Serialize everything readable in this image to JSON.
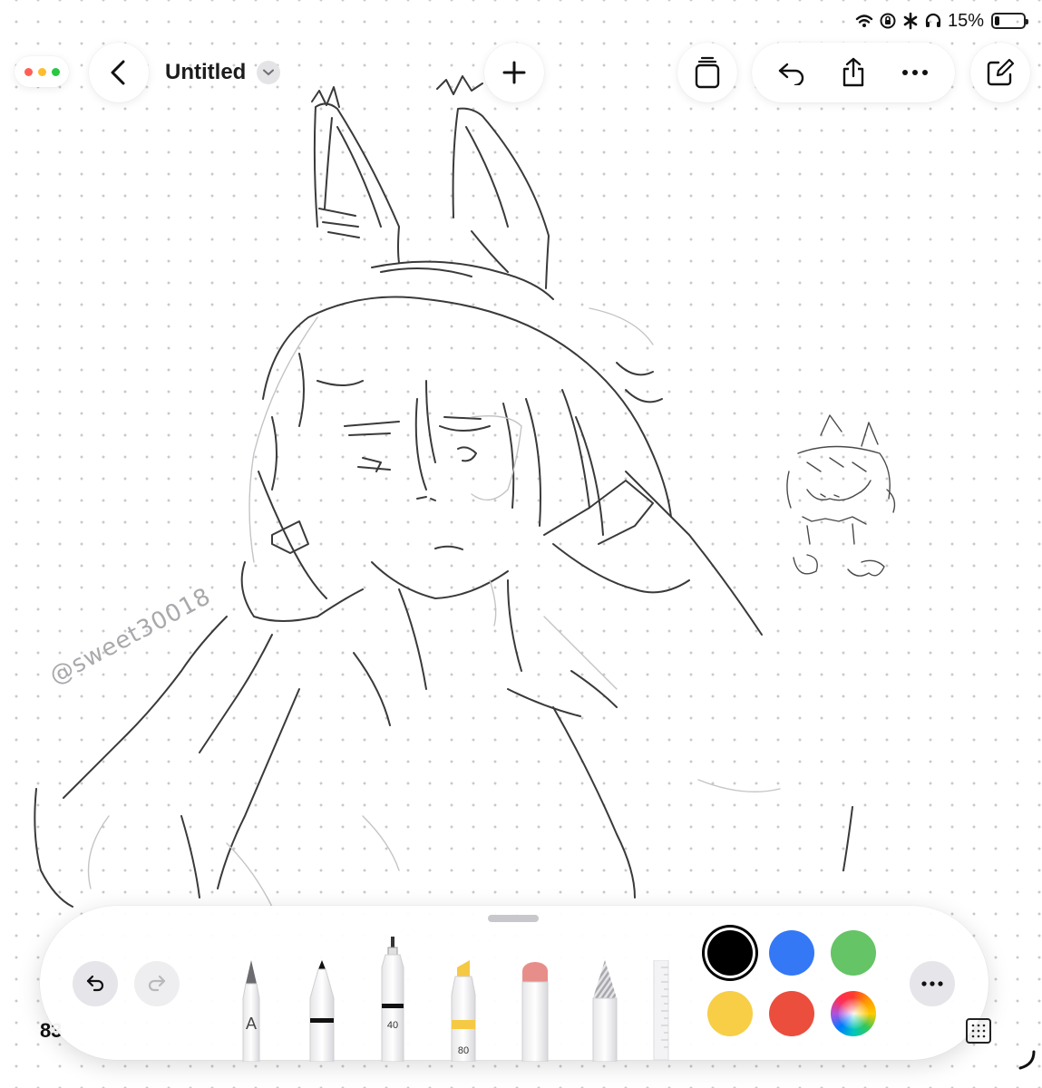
{
  "status_bar": {
    "battery_percent": "15%",
    "battery_level": 0.15,
    "icons": [
      "wifi-icon",
      "orientation-lock-icon",
      "bluetooth-icon",
      "headphones-icon",
      "battery-icon"
    ]
  },
  "window_controls": {
    "dot_colors": [
      "#ff5f57",
      "#febc2e",
      "#28c840"
    ]
  },
  "header": {
    "title": "Untitled"
  },
  "canvas": {
    "watermark": "@sweet30018"
  },
  "bottom_bar": {
    "zoom": "83"
  },
  "palette": {
    "tools": [
      {
        "name": "pen-tool",
        "label": "A"
      },
      {
        "name": "marker-tool",
        "label": ""
      },
      {
        "name": "fineliner-tool",
        "label": "40"
      },
      {
        "name": "highlighter-tool",
        "label": "80"
      },
      {
        "name": "eraser-tool",
        "label": ""
      },
      {
        "name": "pencil-tool",
        "label": ""
      }
    ],
    "colors": [
      {
        "name": "black",
        "hex": "#000000",
        "selected": true
      },
      {
        "name": "blue",
        "hex": "#3478f6",
        "selected": false
      },
      {
        "name": "green",
        "hex": "#65c466",
        "selected": false
      },
      {
        "name": "yellow",
        "hex": "#f7ce46",
        "selected": false
      },
      {
        "name": "red",
        "hex": "#eb4e3d",
        "selected": false
      },
      {
        "name": "multicolor",
        "hex": "spectrum",
        "selected": false
      }
    ],
    "accent_highlighter": "#f5c944"
  }
}
